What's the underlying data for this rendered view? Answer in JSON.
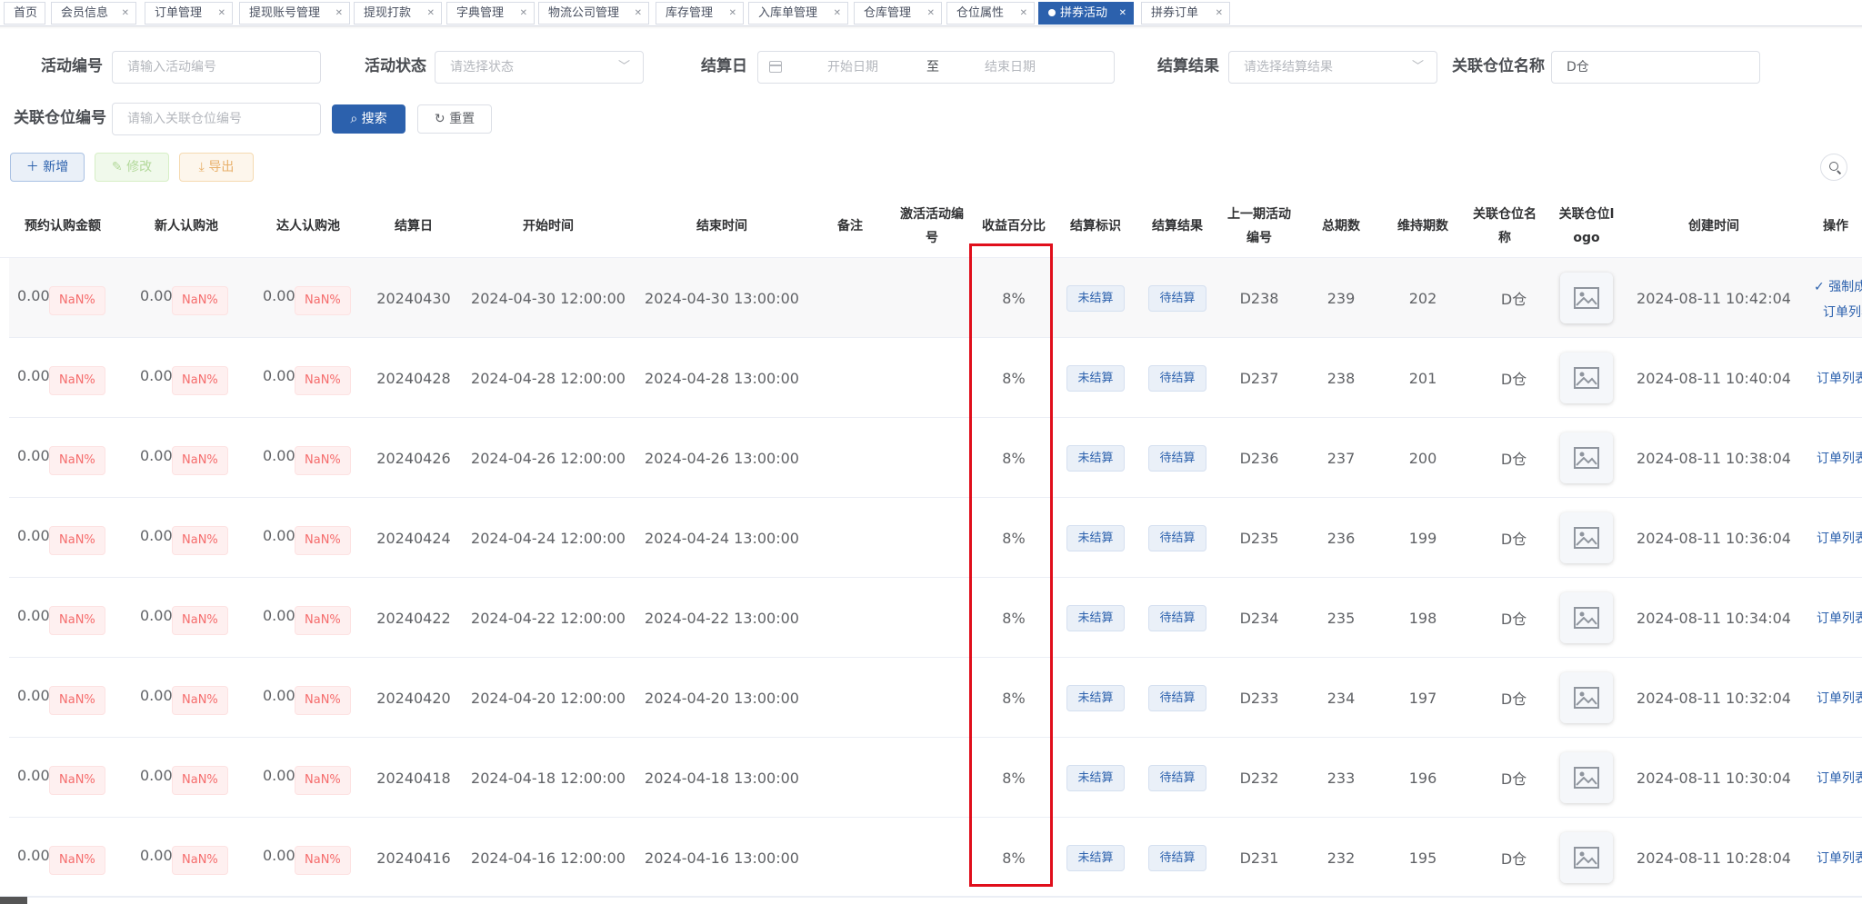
{
  "tabs": [
    {
      "label": "首页",
      "closable": false
    },
    {
      "label": "会员信息",
      "closable": true
    },
    {
      "label": "订单管理",
      "closable": true
    },
    {
      "label": "提现账号管理",
      "closable": true
    },
    {
      "label": "提现打款",
      "closable": true
    },
    {
      "label": "字典管理",
      "closable": true
    },
    {
      "label": "物流公司管理",
      "closable": true
    },
    {
      "label": "库存管理",
      "closable": true
    },
    {
      "label": "入库单管理",
      "closable": true
    },
    {
      "label": "仓库管理",
      "closable": true
    },
    {
      "label": "仓位属性",
      "closable": true
    },
    {
      "label": "拼券活动",
      "closable": true,
      "active": true
    },
    {
      "label": "拼券订单",
      "closable": true
    }
  ],
  "filters": {
    "activity_no_label": "活动编号",
    "activity_no_placeholder": "请输入活动编号",
    "status_label": "活动状态",
    "status_placeholder": "请选择状态",
    "settle_day_label": "结算日",
    "start_date_placeholder": "开始日期",
    "date_separator": "至",
    "end_date_placeholder": "结束日期",
    "settle_result_label": "结算结果",
    "settle_result_placeholder": "请选择结算结果",
    "warehouse_name_label": "关联仓位名称",
    "warehouse_name_value": "D仓",
    "warehouse_no_label": "关联仓位编号",
    "warehouse_no_placeholder": "请输入关联仓位编号",
    "search_label": "搜索",
    "reset_label": "重置"
  },
  "toolbar": {
    "add_label": "新增",
    "edit_label": "修改",
    "export_label": "导出"
  },
  "columns": {
    "reserve": "预约认购金额",
    "newbie": "新人认购池",
    "expert": "达人认购池",
    "settle_day": "结算日",
    "start": "开始时间",
    "end": "结束时间",
    "remark": "备注",
    "activate_no": "激活活动编号",
    "yield": "收益百分比",
    "settle_flag": "结算标识",
    "settle_result": "结算结果",
    "prev_no": "上一期活动编号",
    "total": "总期数",
    "maintain": "维持期数",
    "wh_name": "关联仓位名称",
    "wh_logo": "关联仓位logo",
    "created": "创建时间",
    "ops": "操作"
  },
  "ops": {
    "force_label": "强制成",
    "orders_label": "订单列表"
  },
  "rows": [
    {
      "reserve": "0.00",
      "reserve_pct": "NaN%",
      "newbie": "0.00",
      "newbie_pct": "NaN%",
      "expert": "0.00",
      "expert_pct": "NaN%",
      "settle_day": "20240430",
      "start": "2024-04-30 12:00:00",
      "end": "2024-04-30 13:00:00",
      "yield": "8%",
      "flag": "未结算",
      "result": "待结算",
      "prev": "D238",
      "total": "239",
      "maintain": "202",
      "wh": "D仓",
      "created": "2024-08-11 10:42:04"
    },
    {
      "reserve": "0.00",
      "reserve_pct": "NaN%",
      "newbie": "0.00",
      "newbie_pct": "NaN%",
      "expert": "0.00",
      "expert_pct": "NaN%",
      "settle_day": "20240428",
      "start": "2024-04-28 12:00:00",
      "end": "2024-04-28 13:00:00",
      "yield": "8%",
      "flag": "未结算",
      "result": "待结算",
      "prev": "D237",
      "total": "238",
      "maintain": "201",
      "wh": "D仓",
      "created": "2024-08-11 10:40:04"
    },
    {
      "reserve": "0.00",
      "reserve_pct": "NaN%",
      "newbie": "0.00",
      "newbie_pct": "NaN%",
      "expert": "0.00",
      "expert_pct": "NaN%",
      "settle_day": "20240426",
      "start": "2024-04-26 12:00:00",
      "end": "2024-04-26 13:00:00",
      "yield": "8%",
      "flag": "未结算",
      "result": "待结算",
      "prev": "D236",
      "total": "237",
      "maintain": "200",
      "wh": "D仓",
      "created": "2024-08-11 10:38:04"
    },
    {
      "reserve": "0.00",
      "reserve_pct": "NaN%",
      "newbie": "0.00",
      "newbie_pct": "NaN%",
      "expert": "0.00",
      "expert_pct": "NaN%",
      "settle_day": "20240424",
      "start": "2024-04-24 12:00:00",
      "end": "2024-04-24 13:00:00",
      "yield": "8%",
      "flag": "未结算",
      "result": "待结算",
      "prev": "D235",
      "total": "236",
      "maintain": "199",
      "wh": "D仓",
      "created": "2024-08-11 10:36:04"
    },
    {
      "reserve": "0.00",
      "reserve_pct": "NaN%",
      "newbie": "0.00",
      "newbie_pct": "NaN%",
      "expert": "0.00",
      "expert_pct": "NaN%",
      "settle_day": "20240422",
      "start": "2024-04-22 12:00:00",
      "end": "2024-04-22 13:00:00",
      "yield": "8%",
      "flag": "未结算",
      "result": "待结算",
      "prev": "D234",
      "total": "235",
      "maintain": "198",
      "wh": "D仓",
      "created": "2024-08-11 10:34:04"
    },
    {
      "reserve": "0.00",
      "reserve_pct": "NaN%",
      "newbie": "0.00",
      "newbie_pct": "NaN%",
      "expert": "0.00",
      "expert_pct": "NaN%",
      "settle_day": "20240420",
      "start": "2024-04-20 12:00:00",
      "end": "2024-04-20 13:00:00",
      "yield": "8%",
      "flag": "未结算",
      "result": "待结算",
      "prev": "D233",
      "total": "234",
      "maintain": "197",
      "wh": "D仓",
      "created": "2024-08-11 10:32:04"
    },
    {
      "reserve": "0.00",
      "reserve_pct": "NaN%",
      "newbie": "0.00",
      "newbie_pct": "NaN%",
      "expert": "0.00",
      "expert_pct": "NaN%",
      "settle_day": "20240418",
      "start": "2024-04-18 12:00:00",
      "end": "2024-04-18 13:00:00",
      "yield": "8%",
      "flag": "未结算",
      "result": "待结算",
      "prev": "D232",
      "total": "233",
      "maintain": "196",
      "wh": "D仓",
      "created": "2024-08-11 10:30:04"
    },
    {
      "reserve": "0.00",
      "reserve_pct": "NaN%",
      "newbie": "0.00",
      "newbie_pct": "NaN%",
      "expert": "0.00",
      "expert_pct": "NaN%",
      "settle_day": "20240416",
      "start": "2024-04-16 12:00:00",
      "end": "2024-04-16 13:00:00",
      "yield": "8%",
      "flag": "未结算",
      "result": "待结算",
      "prev": "D231",
      "total": "232",
      "maintain": "195",
      "wh": "D仓",
      "created": "2024-08-11 10:28:04"
    }
  ],
  "colors": {
    "primary": "#2c61ad",
    "danger": "#f56c6c",
    "highlight": "#e00e1b"
  }
}
